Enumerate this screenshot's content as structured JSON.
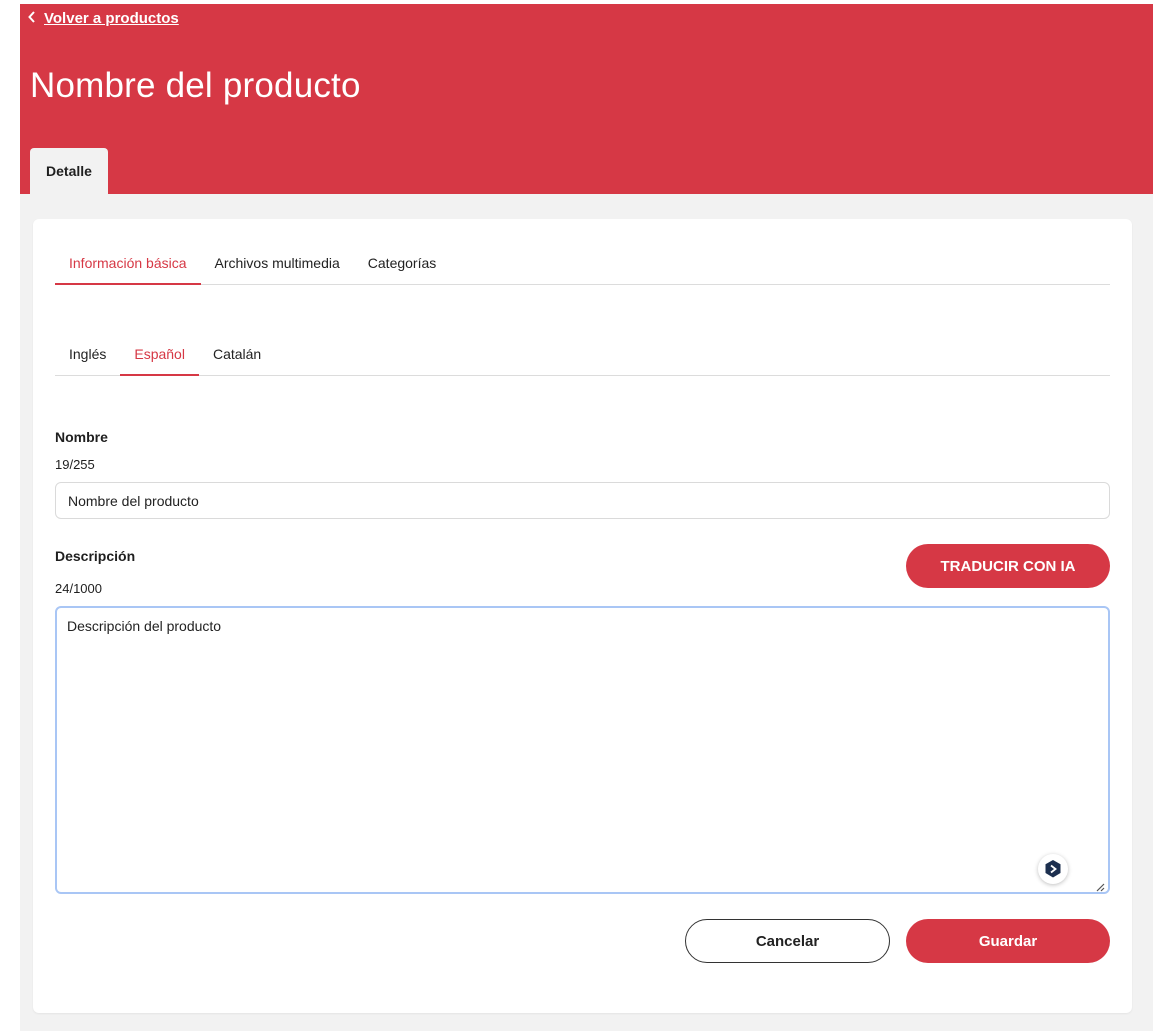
{
  "header": {
    "back_link": "Volver a productos",
    "title": "Nombre del producto",
    "tab": "Detalle"
  },
  "tabs": {
    "main": [
      "Información básica",
      "Archivos multimedia",
      "Categorías"
    ],
    "main_active": 0,
    "languages": [
      "Inglés",
      "Español",
      "Catalán"
    ],
    "languages_active": 1
  },
  "form": {
    "name_label": "Nombre",
    "name_counter": "19/255",
    "name_value": "Nombre del producto",
    "description_label": "Descripción",
    "description_counter": "24/1000",
    "description_value": "Descripción del producto"
  },
  "buttons": {
    "translate": "TRADUCIR CON IA",
    "cancel": "Cancelar",
    "save": "Guardar"
  },
  "colors": {
    "brand": "#d63845",
    "focus_border": "#a9c6f5",
    "ai_badge": "#1c2f4f"
  },
  "icons": {
    "back": "chevron-left-icon",
    "ai_badge": "ai-assistant-icon",
    "resize": "resize-handle-icon"
  }
}
